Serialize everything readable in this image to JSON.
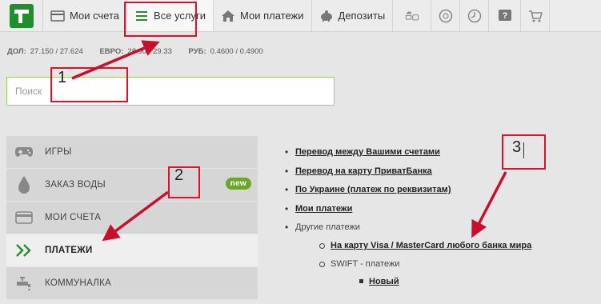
{
  "topnav": {
    "items": [
      {
        "label": "Мои счета",
        "icon": "wallet-icon"
      },
      {
        "label": "Все услуги",
        "icon": "list-icon"
      },
      {
        "label": "Мои платежи",
        "icon": "home-icon"
      },
      {
        "label": "Депозиты",
        "icon": "piggy-bank-icon"
      }
    ],
    "extra_icons": [
      "transport-icon",
      "globe-icon",
      "clock-icon",
      "help-icon",
      "cart-icon"
    ]
  },
  "rates": [
    {
      "label": "ДОЛ:",
      "value": "27.150 / 27.624"
    },
    {
      "label": "ЕВРО:",
      "value": "28.90 / 29.33"
    },
    {
      "label": "РУБ:",
      "value": "0.4600 / 0.4900"
    }
  ],
  "search": {
    "placeholder": "Поиск"
  },
  "sidebar": {
    "items": [
      {
        "label": "ИГРЫ",
        "icon": "gamepad-icon"
      },
      {
        "label": "ЗАКАЗ ВОДЫ",
        "icon": "water-drop-icon",
        "badge": "new"
      },
      {
        "label": "МОИ СЧЕТА",
        "icon": "card-icon"
      },
      {
        "label": "ПЛАТЕЖИ",
        "icon": "double-chevron-icon"
      },
      {
        "label": "КОММУНАЛКА",
        "icon": "tap-icon"
      }
    ]
  },
  "links": {
    "items": [
      "Перевод между Вашими счетами",
      "Перевод на карту ПриватБанка",
      "По Украине (платеж по реквизитам)",
      "Мои платежи"
    ],
    "other_label": "Другие платежи",
    "sub_items": [
      "На карту Visa / MasterCard любого банка мира"
    ],
    "swift_label": "SWIFT - платежи",
    "swift_items": [
      "Новый"
    ]
  },
  "annotations": {
    "n1": "1",
    "n2": "2",
    "n3": "3"
  },
  "colors": {
    "accent_green": "#1f8f2c",
    "annotation_red": "#e0102a",
    "badge_green": "#6aa52c"
  }
}
